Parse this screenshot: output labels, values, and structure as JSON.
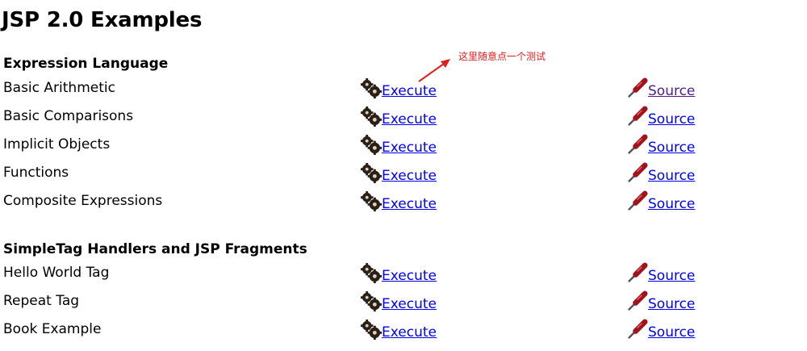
{
  "page": {
    "title": "JSP 2.0 Examples",
    "annotation": "这里随意点一个测试"
  },
  "sections": [
    {
      "title": "Expression Language",
      "rows": [
        {
          "label": "Basic Arithmetic",
          "execute": "Execute",
          "source": "Source",
          "source_visited": true
        },
        {
          "label": "Basic Comparisons",
          "execute": "Execute",
          "source": "Source",
          "source_visited": false
        },
        {
          "label": "Implicit Objects",
          "execute": "Execute",
          "source": "Source",
          "source_visited": false
        },
        {
          "label": "Functions",
          "execute": "Execute",
          "source": "Source",
          "source_visited": false
        },
        {
          "label": "Composite Expressions",
          "execute": "Execute",
          "source": "Source",
          "source_visited": false
        }
      ]
    },
    {
      "title": "SimpleTag Handlers and JSP Fragments",
      "rows": [
        {
          "label": "Hello World Tag",
          "execute": "Execute",
          "source": "Source",
          "source_visited": false
        },
        {
          "label": "Repeat Tag",
          "execute": "Execute",
          "source": "Source",
          "source_visited": false
        },
        {
          "label": "Book Example",
          "execute": "Execute",
          "source": "Source",
          "source_visited": false
        }
      ]
    }
  ],
  "icons": {
    "execute": "gears-icon",
    "source": "screwdriver-icon"
  },
  "colors": {
    "link": "#0000ee",
    "visited": "#551a8b",
    "annotation": "#e02020"
  }
}
